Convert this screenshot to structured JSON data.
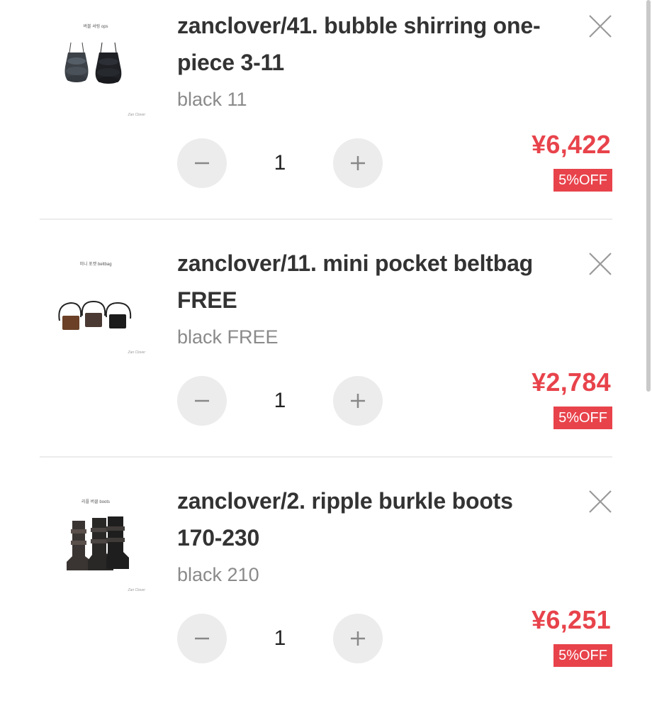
{
  "cart": {
    "items": [
      {
        "title": "zanclover/41. bubble shirring one-piece 3-11",
        "variant": "black 11",
        "quantity": "1",
        "price": "¥6,422",
        "discount": "5%OFF",
        "image_caption": "버블 셔링 ops",
        "image_watermark": "Zan Clover",
        "image_kind": "dress"
      },
      {
        "title": "zanclover/11. mini pocket beltbag FREE",
        "variant": "black FREE",
        "quantity": "1",
        "price": "¥2,784",
        "discount": "5%OFF",
        "image_caption": "미니 포켓 beltbag",
        "image_watermark": "Zan Clover",
        "image_kind": "beltbag"
      },
      {
        "title": "zanclover/2. ripple burkle boots 170-230",
        "variant": "black 210",
        "quantity": "1",
        "price": "¥6,251",
        "discount": "5%OFF",
        "image_caption": "리플 버클 boots",
        "image_watermark": "Zan Clover",
        "image_kind": "boots"
      }
    ],
    "icons": {
      "remove": "close-icon",
      "decrease": "minus-icon",
      "increase": "plus-icon"
    },
    "colors": {
      "price": "#e8434b",
      "badge_bg": "#e8434b",
      "button_bg": "#ececec",
      "title": "#333333",
      "variant": "#8a8a8a"
    }
  }
}
